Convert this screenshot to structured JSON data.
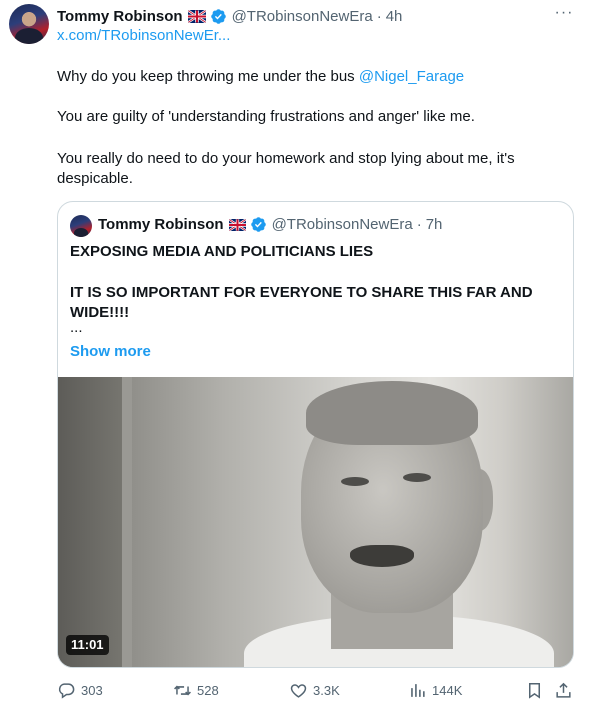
{
  "tweet": {
    "author_name": "Tommy Robinson",
    "author_handle": "@TRobinsonNewEra",
    "separator": "·",
    "time": "4h",
    "link_text": "x.com/TRobinsonNewEr...",
    "paragraph1_text": "Why do you keep throwing me under the bus ",
    "paragraph1_mention": "@Nigel_Farage",
    "paragraph2": "You are guilty of 'understanding frustrations and anger' like me.",
    "paragraph3": "You really do need to do your homework and stop lying about me, it's despicable.",
    "more_icon": "more-icon"
  },
  "quote": {
    "author_name": "Tommy Robinson",
    "author_handle": "@TRobinsonNewEra",
    "separator": "·",
    "time": "7h",
    "line1": "EXPOSING MEDIA AND POLITICIANS LIES",
    "line2": "IT IS SO IMPORTANT FOR EVERYONE TO SHARE THIS FAR AND WIDE!!!!",
    "ellipsis": "...",
    "show_more": "Show more",
    "video_duration": "11:01"
  },
  "actions": {
    "replies": "303",
    "reposts": "528",
    "likes": "3.3K",
    "views": "144K"
  },
  "colors": {
    "accent": "#1d9bf0",
    "secondary_text": "#536471",
    "border": "#cfd9de"
  }
}
